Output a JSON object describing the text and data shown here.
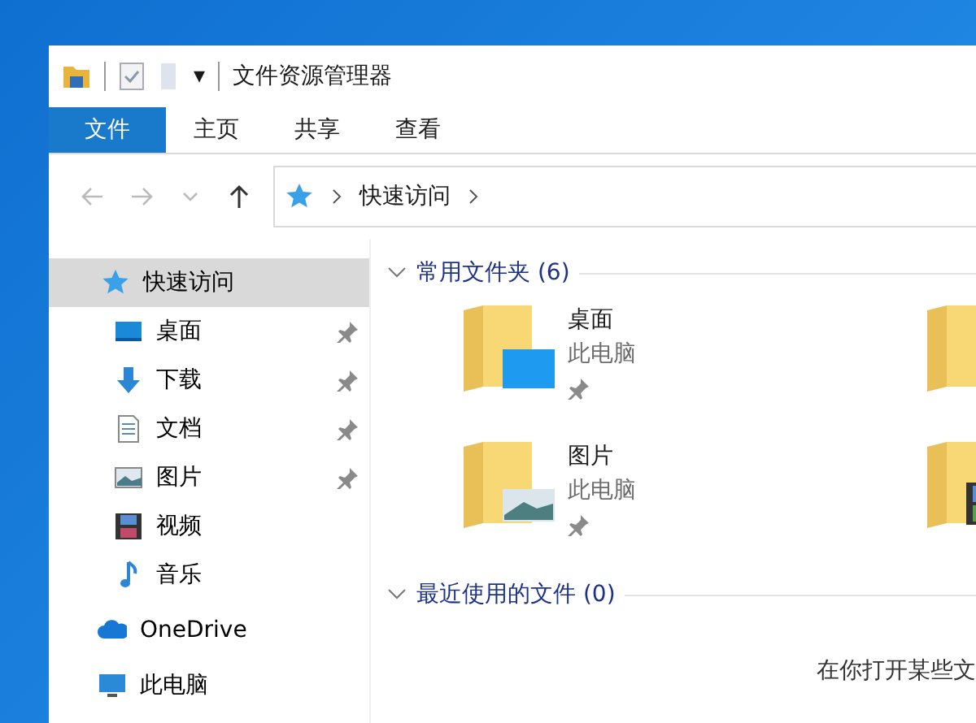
{
  "window": {
    "title": "文件资源管理器",
    "qat_dropdown": "▾"
  },
  "ribbon_tabs": [
    {
      "label": "文件",
      "selected": true
    },
    {
      "label": "主页",
      "selected": false
    },
    {
      "label": "共享",
      "selected": false
    },
    {
      "label": "查看",
      "selected": false
    }
  ],
  "address_bar": {
    "path": [
      "快速访问"
    ]
  },
  "nav_pane": {
    "items": [
      {
        "label": "快速访问",
        "kind": "star",
        "selected": true,
        "children": [
          {
            "label": "桌面",
            "kind": "desktop",
            "selected": false,
            "pinned": true
          },
          {
            "label": "下载",
            "kind": "download",
            "selected": false,
            "pinned": true
          },
          {
            "label": "文档",
            "kind": "document",
            "selected": false,
            "pinned": true
          },
          {
            "label": "图片",
            "kind": "picture",
            "selected": false,
            "pinned": true
          },
          {
            "label": "视频",
            "kind": "video",
            "selected": false,
            "pinned": false
          },
          {
            "label": "音乐",
            "kind": "music",
            "selected": false,
            "pinned": false
          }
        ]
      },
      {
        "label": "OneDrive",
        "kind": "cloud",
        "selected": false
      },
      {
        "label": "此电脑",
        "kind": "pc",
        "selected": false
      }
    ]
  },
  "sections": [
    {
      "title": "常用文件夹 (6)",
      "expanded": true,
      "folders": [
        {
          "name": "桌面",
          "location": "此电脑",
          "pinned": true,
          "kind": "desktop"
        },
        {
          "kind": "download"
        },
        {
          "name": "图片",
          "location": "此电脑",
          "pinned": true,
          "kind": "picture"
        },
        {
          "kind": "video"
        }
      ]
    },
    {
      "title": "最近使用的文件 (0)",
      "expanded": true,
      "message": "在你打开某些文"
    }
  ]
}
